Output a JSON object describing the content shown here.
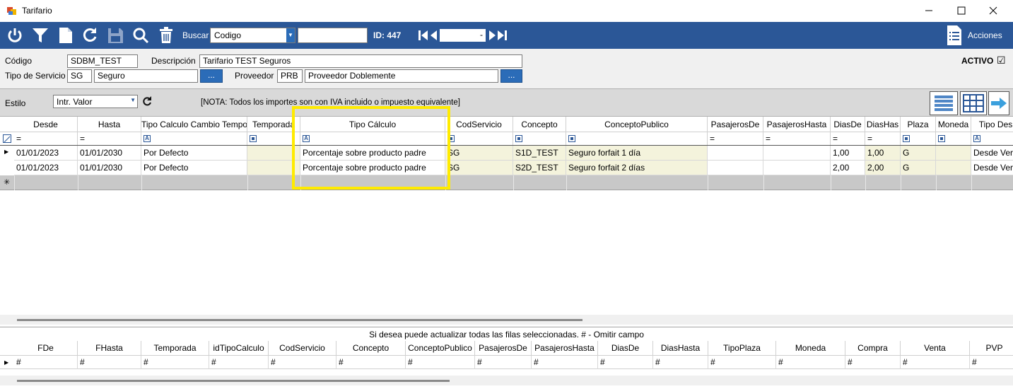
{
  "window": {
    "title": "Tarifario"
  },
  "toolbar": {
    "buscar_label": "Buscar",
    "buscar_select_value": "Codigo",
    "buscar_input_value": "",
    "id_label": "ID: 447",
    "nav_value": "-",
    "acciones_label": "Acciones"
  },
  "form": {
    "codigo_label": "Código",
    "codigo_value": "SDBM_TEST",
    "descripcion_label": "Descripción",
    "descripcion_value": "Tarifario TEST Seguros",
    "tipo_servicio_label": "Tipo de Servicio",
    "tipo_servicio_code": "SG",
    "tipo_servicio_name": "Seguro",
    "proveedor_label": "Proveedor",
    "proveedor_code": "PRB",
    "proveedor_name": "Proveedor Doblemente",
    "dots_label": "...",
    "activo_label": "ACTIVO",
    "activo_check": "☑"
  },
  "stylebar": {
    "estilo_label": "Estilo",
    "estilo_value": "Intr. Valor",
    "nota": "[NOTA: Todos los importes son con IVA incluido o impuesto equivalente]"
  },
  "grid": {
    "columns": [
      "Desde",
      "Hasta",
      "Tipo Calculo Cambio Tempor",
      "Temporada",
      "Tipo Cálculo",
      "CodServicio",
      "Concepto",
      "ConceptoPublico",
      "PasajerosDe",
      "PasajerosHasta",
      "DiasDe",
      "DiasHas",
      "Plaza",
      "Moneda",
      "Tipo Des"
    ],
    "filter_eq": "=",
    "rows": [
      [
        "01/01/2023",
        "01/01/2030",
        "Por Defecto",
        "",
        "Porcentaje sobre producto padre",
        "SG",
        "S1D_TEST",
        "Seguro forfait 1 día",
        "",
        "",
        "1,00",
        "1,00",
        "G",
        "",
        "Desde Ver"
      ],
      [
        "01/01/2023",
        "01/01/2030",
        "Por Defecto",
        "",
        "Porcentaje sobre producto padre",
        "SG",
        "S2D_TEST",
        "Seguro forfait 2 días",
        "",
        "",
        "2,00",
        "2,00",
        "G",
        "",
        "Desde Ver"
      ]
    ],
    "new_row_marker": "✳",
    "current_row_marker": "▶"
  },
  "bulk": {
    "message": "Si desea puede actualizar todas las filas seleccionadas. # - Omitir campo",
    "columns": [
      "FDe",
      "FHasta",
      "Temporada",
      "idTipoCalculo",
      "CodServicio",
      "Concepto",
      "ConceptoPublico",
      "PasajerosDe",
      "PasajerosHasta",
      "DiasDe",
      "DiasHasta",
      "TipoPlaza",
      "Moneda",
      "Compra",
      "Venta",
      "PVP"
    ],
    "omit_marker": "#"
  },
  "colors": {
    "toolbar_bg": "#2b5797",
    "highlight": "#ffeb00",
    "cell_tint": "#f4f3dc"
  }
}
